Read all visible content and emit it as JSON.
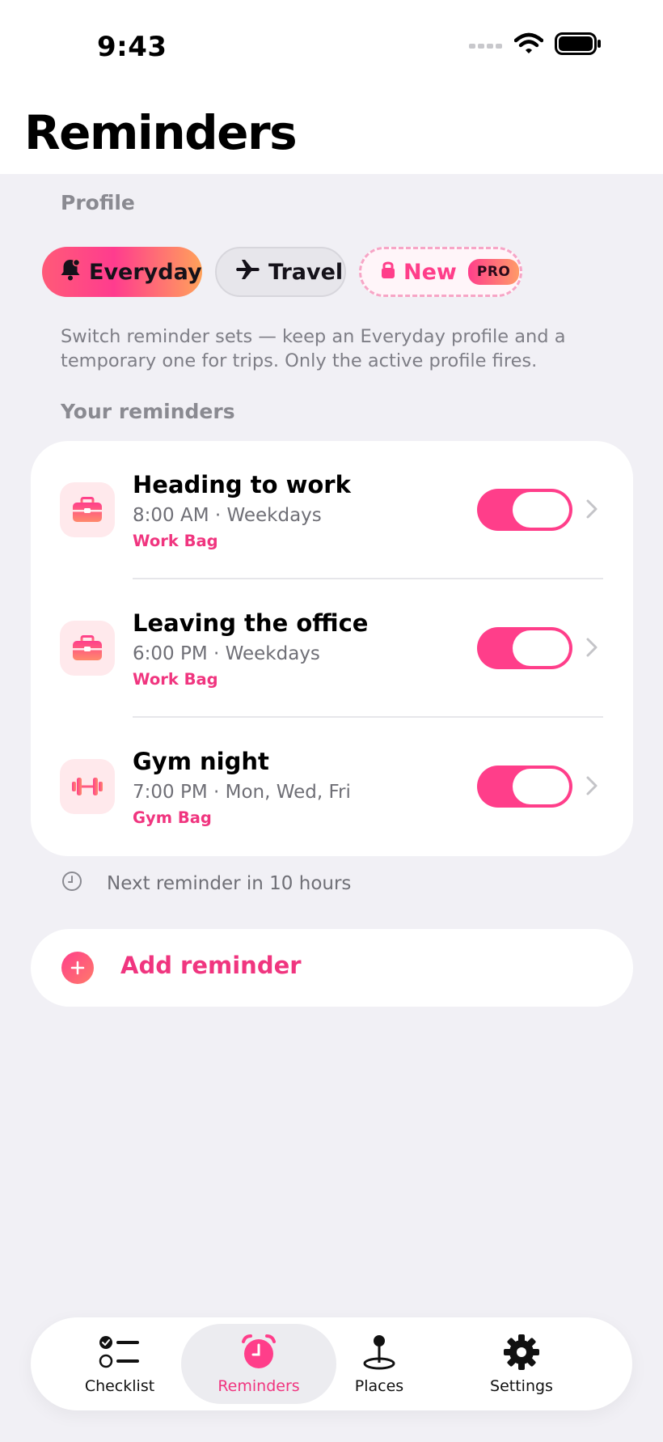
{
  "status_bar": {
    "time": "9:43"
  },
  "header": {
    "title": "Reminders"
  },
  "profile": {
    "section_label": "Profile",
    "chips": [
      {
        "label": "Everyday",
        "icon": "bell-icon",
        "state": "active"
      },
      {
        "label": "Travel",
        "icon": "airplane-icon",
        "state": "inactive"
      },
      {
        "label": "New",
        "icon": "lock-icon",
        "badge": "PRO",
        "state": "locked"
      }
    ],
    "helper_text": "Switch reminder sets — keep an Everyday profile and a temporary one for trips. Only the active profile fires."
  },
  "reminders": {
    "section_label": "Your reminders",
    "items": [
      {
        "title": "Heading to work",
        "time": "8:00 AM · Weekdays",
        "bag": "Work Bag",
        "icon": "briefcase-icon",
        "enabled": true
      },
      {
        "title": "Leaving the office",
        "time": "6:00 PM · Weekdays",
        "bag": "Work Bag",
        "icon": "briefcase-icon",
        "enabled": true
      },
      {
        "title": "Gym night",
        "time": "7:00 PM · Mon, Wed, Fri",
        "bag": "Gym Bag",
        "icon": "dumbbell-icon",
        "enabled": true
      }
    ],
    "next_reminder": "Next reminder in 10 hours",
    "add_label": "Add reminder"
  },
  "tab_bar": {
    "tabs": [
      {
        "label": "Checklist",
        "icon": "checklist-icon",
        "active": false
      },
      {
        "label": "Reminders",
        "icon": "alarm-clock-icon",
        "active": true
      },
      {
        "label": "Places",
        "icon": "map-pin-icon",
        "active": false
      },
      {
        "label": "Settings",
        "icon": "gear-icon",
        "active": false
      }
    ]
  },
  "colors": {
    "accent": "#f0357f",
    "toggle_on": "#ff3e8a",
    "background": "#f1f0f5",
    "icon_tile": "#ffe9ec"
  }
}
